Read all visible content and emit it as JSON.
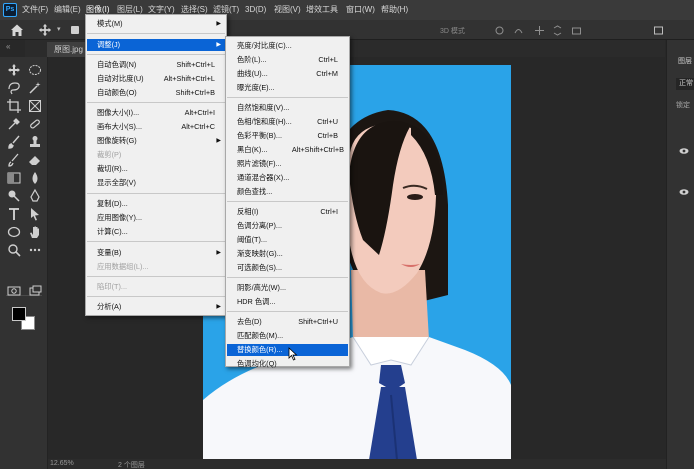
{
  "menubar": {
    "items": [
      "文件(F)",
      "编辑(E)",
      "图像(I)",
      "图层(L)",
      "文字(Y)",
      "选择(S)",
      "滤镜(T)",
      "3D(D)",
      "视图(V)",
      "增效工具",
      "窗口(W)",
      "帮助(H)"
    ]
  },
  "options_bar": {
    "mode_3d": "3D 模式"
  },
  "document": {
    "tab_title": "原图.jpg"
  },
  "status": {
    "zoom": "12.65%",
    "info": "2 个图层"
  },
  "right_panel": {
    "tab": "图层",
    "field": "正常",
    "lock": "锁定"
  },
  "image_menu": {
    "items": [
      {
        "label": "模式(M)",
        "shortcut": "",
        "submenu": true
      },
      {
        "label": "调整(J)",
        "shortcut": "",
        "submenu": true,
        "highlighted": true
      },
      {
        "label": "自动色调(N)",
        "shortcut": "Shift+Ctrl+L"
      },
      {
        "label": "自动对比度(U)",
        "shortcut": "Alt+Shift+Ctrl+L"
      },
      {
        "label": "自动颜色(O)",
        "shortcut": "Shift+Ctrl+B"
      },
      {
        "label": "图像大小(I)...",
        "shortcut": "Alt+Ctrl+I"
      },
      {
        "label": "画布大小(S)...",
        "shortcut": "Alt+Ctrl+C"
      },
      {
        "label": "图像旋转(G)",
        "shortcut": "",
        "submenu": true
      },
      {
        "label": "裁剪(P)",
        "shortcut": "",
        "disabled": true
      },
      {
        "label": "裁切(R)...",
        "shortcut": ""
      },
      {
        "label": "显示全部(V)",
        "shortcut": ""
      },
      {
        "label": "复制(D)...",
        "shortcut": ""
      },
      {
        "label": "应用图像(Y)...",
        "shortcut": ""
      },
      {
        "label": "计算(C)...",
        "shortcut": ""
      },
      {
        "label": "变量(B)",
        "shortcut": "",
        "submenu": true
      },
      {
        "label": "应用数据组(L)...",
        "shortcut": "",
        "disabled": true
      },
      {
        "label": "陷印(T)...",
        "shortcut": "",
        "disabled": true
      },
      {
        "label": "分析(A)",
        "shortcut": "",
        "submenu": true
      }
    ]
  },
  "adjust_menu": {
    "items": [
      {
        "label": "亮度/对比度(C)...",
        "shortcut": ""
      },
      {
        "label": "色阶(L)...",
        "shortcut": "Ctrl+L"
      },
      {
        "label": "曲线(U)...",
        "shortcut": "Ctrl+M"
      },
      {
        "label": "曝光度(E)...",
        "shortcut": ""
      },
      {
        "label": "自然饱和度(V)...",
        "shortcut": ""
      },
      {
        "label": "色相/饱和度(H)...",
        "shortcut": "Ctrl+U"
      },
      {
        "label": "色彩平衡(B)...",
        "shortcut": "Ctrl+B"
      },
      {
        "label": "黑白(K)...",
        "shortcut": "Alt+Shift+Ctrl+B"
      },
      {
        "label": "照片滤镜(F)...",
        "shortcut": ""
      },
      {
        "label": "通道混合器(X)...",
        "shortcut": ""
      },
      {
        "label": "颜色查找...",
        "shortcut": ""
      },
      {
        "label": "反相(I)",
        "shortcut": "Ctrl+I"
      },
      {
        "label": "色调分离(P)...",
        "shortcut": ""
      },
      {
        "label": "阈值(T)...",
        "shortcut": ""
      },
      {
        "label": "渐变映射(G)...",
        "shortcut": ""
      },
      {
        "label": "可选颜色(S)...",
        "shortcut": ""
      },
      {
        "label": "阴影/高光(W)...",
        "shortcut": ""
      },
      {
        "label": "HDR 色调...",
        "shortcut": ""
      },
      {
        "label": "去色(D)",
        "shortcut": "Shift+Ctrl+U"
      },
      {
        "label": "匹配颜色(M)...",
        "shortcut": ""
      },
      {
        "label": "替换颜色(R)...",
        "shortcut": "",
        "highlighted": true
      },
      {
        "label": "色调均化(Q)",
        "shortcut": ""
      }
    ]
  },
  "colors": {
    "photo_background": "#2aa3e8",
    "menu_highlight": "#0a64d6",
    "tie": "#243f8e"
  }
}
